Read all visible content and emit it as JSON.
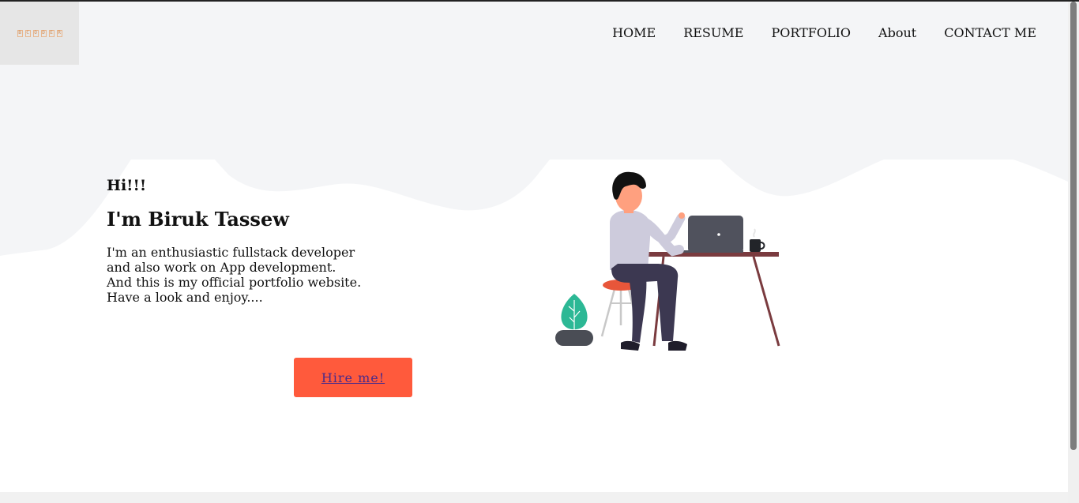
{
  "logo": {
    "letters": [
      "B",
      "C",
      "O",
      "D",
      "E",
      "R"
    ]
  },
  "nav": {
    "items": [
      {
        "label": "HOME"
      },
      {
        "label": "RESUME"
      },
      {
        "label": "PORTFOLIO"
      },
      {
        "label": "About"
      },
      {
        "label": "CONTACT ME"
      }
    ]
  },
  "hero": {
    "greeting": "Hi!!!",
    "name": "I'm Biruk Tassew",
    "bio_lines": [
      "I'm an enthusiastic fullstack developer",
      "and also work on App development.",
      "And this is my official portfolio website.",
      "Have a look and enjoy...."
    ],
    "hire_label": "Hire me!"
  },
  "colors": {
    "accent": "#ff5a3c",
    "header_bg": "#f4f5f7",
    "link": "#4a2a8a"
  },
  "icons": {
    "illustration": "person-at-desk-with-laptop-illustration"
  }
}
